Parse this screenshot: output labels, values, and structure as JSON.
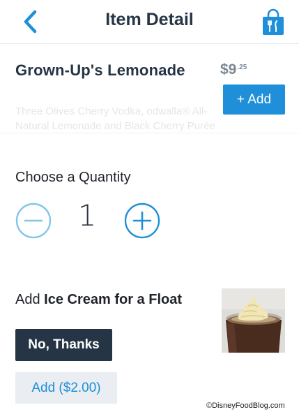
{
  "header": {
    "title": "Item Detail",
    "back_icon": "chevron-left-icon",
    "bag_icon": "shopping-bag-fork-knife-icon"
  },
  "item": {
    "name": "Grown-Up's Lemonade",
    "price_dollars": "$9",
    "price_cents": ".25",
    "add_label": "+ Add",
    "description": "Three Olives Cherry Vodka, odwalla® All-Natural Lemonade and Black Cherry Purée"
  },
  "quantity": {
    "label": "Choose a Quantity",
    "value": "1",
    "minus_icon": "minus-circle-icon",
    "plus_icon": "plus-circle-icon"
  },
  "addon": {
    "label_prefix": "Add ",
    "label_bold": "Ice Cream for a Float",
    "image": "ice-cream-float-photo",
    "options": [
      {
        "label": "No, Thanks",
        "selected": true
      },
      {
        "label": "Add ($2.00)",
        "selected": false
      }
    ]
  },
  "watermark": "©DisneyFoodBlog.com",
  "colors": {
    "accent": "#1e8fd8",
    "dark": "#253545",
    "secondary_bg": "#eaeef2"
  }
}
